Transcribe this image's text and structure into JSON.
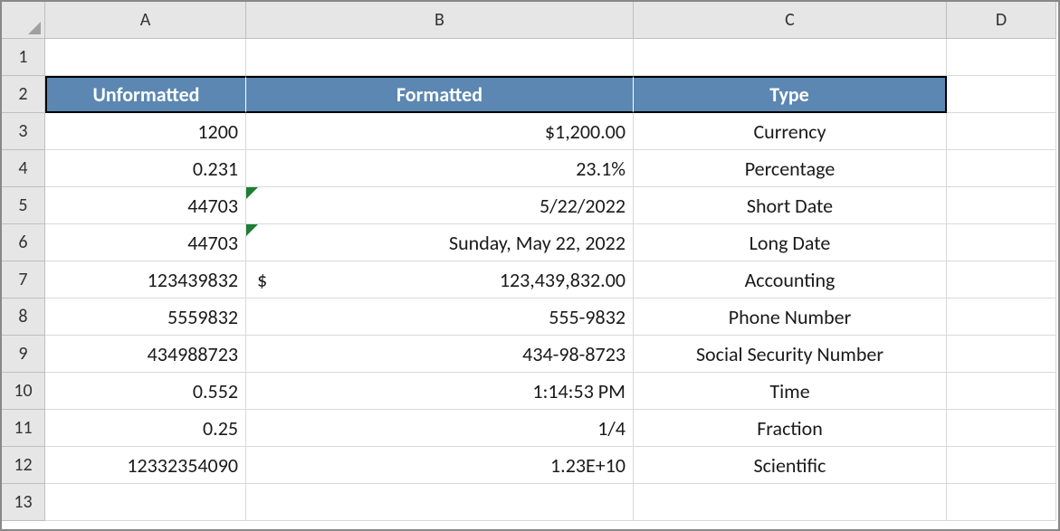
{
  "columns": [
    "A",
    "B",
    "C",
    "D"
  ],
  "rowCount": 13,
  "headers": {
    "a": "Unformatted",
    "b": "Formatted",
    "c": "Type"
  },
  "rows": [
    {
      "unformatted": "1200",
      "formatted": "$1,200.00",
      "type": "Currency",
      "tri": false,
      "acct": false
    },
    {
      "unformatted": "0.231",
      "formatted": "23.1%",
      "type": "Percentage",
      "tri": false,
      "acct": false
    },
    {
      "unformatted": "44703",
      "formatted": "5/22/2022",
      "type": "Short Date",
      "tri": true,
      "acct": false
    },
    {
      "unformatted": "44703",
      "formatted": "Sunday, May 22, 2022",
      "type": "Long Date",
      "tri": true,
      "acct": false
    },
    {
      "unformatted": "123439832",
      "formatted": "123,439,832.00",
      "type": "Accounting",
      "tri": false,
      "acct": true,
      "acctSymbol": "$"
    },
    {
      "unformatted": "5559832",
      "formatted": "555-9832",
      "type": "Phone Number",
      "tri": false,
      "acct": false
    },
    {
      "unformatted": "434988723",
      "formatted": "434-98-8723",
      "type": "Social Security Number",
      "tri": false,
      "acct": false
    },
    {
      "unformatted": "0.552",
      "formatted": "1:14:53 PM",
      "type": "Time",
      "tri": false,
      "acct": false
    },
    {
      "unformatted": "0.25",
      "formatted": "1/4",
      "type": "Fraction",
      "tri": false,
      "acct": false
    },
    {
      "unformatted": "12332354090",
      "formatted": "1.23E+10",
      "type": "Scientific",
      "tri": false,
      "acct": false
    }
  ]
}
